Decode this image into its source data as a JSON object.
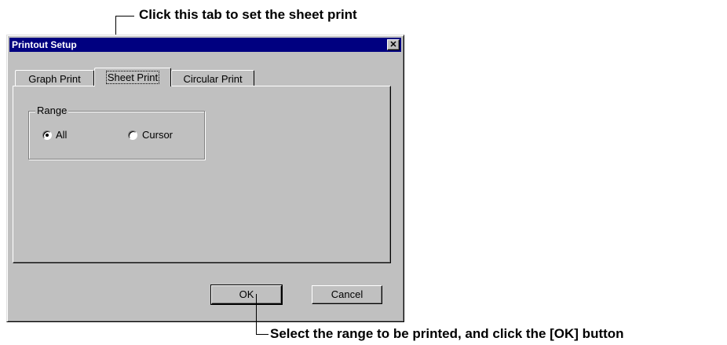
{
  "annotations": {
    "top": "Click this tab to set the sheet print",
    "bottom": "Select the range to be printed, and click the [OK] button"
  },
  "dialog": {
    "title": "Printout Setup",
    "close_glyph": "✕",
    "tabs": [
      {
        "label": "Graph Print",
        "active": false
      },
      {
        "label": "Sheet Print",
        "active": true
      },
      {
        "label": "Circular Print",
        "active": false
      }
    ],
    "range": {
      "label": "Range",
      "options": [
        {
          "label": "All",
          "selected": true
        },
        {
          "label": "Cursor",
          "selected": false
        }
      ]
    },
    "buttons": {
      "ok": "OK",
      "cancel": "Cancel"
    }
  }
}
